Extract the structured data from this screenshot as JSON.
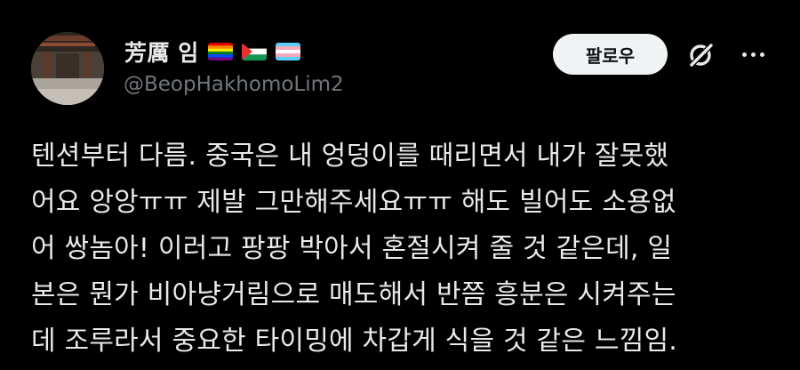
{
  "author": {
    "display_name": "芳厲 임",
    "handle": "@BeopHakhomoLim2",
    "flags": [
      "rainbow-flag-icon",
      "palestine-flag-icon",
      "transgender-flag-icon"
    ]
  },
  "actions": {
    "follow_label": "팔로우",
    "grok_icon": "grok-icon",
    "more_icon": "more-icon"
  },
  "tweet": {
    "lines": [
      "텐션부터 다름. 중국은 내 엉덩이를 때리면서 내가 잘못했",
      "어요 앙앙ㅠㅠ 제발 그만해주세요ㅠㅠ 해도 빌어도 소용없",
      "어 쌍놈아! 이러고 팡팡 박아서 혼절시켜 줄 것 같은데, 일",
      "본은 뭔가 비아냥거림으로 매도해서 반쯤 흥분은 시켜주는",
      "데 조루라서 중요한 타이밍에 차갑게 식을 것 같은 느낌임."
    ]
  },
  "colors": {
    "background": "#000000",
    "text_primary": "#e7e9ea",
    "text_secondary": "#71767b",
    "follow_button_bg": "#eff3f4",
    "follow_button_text": "#0f1419"
  }
}
